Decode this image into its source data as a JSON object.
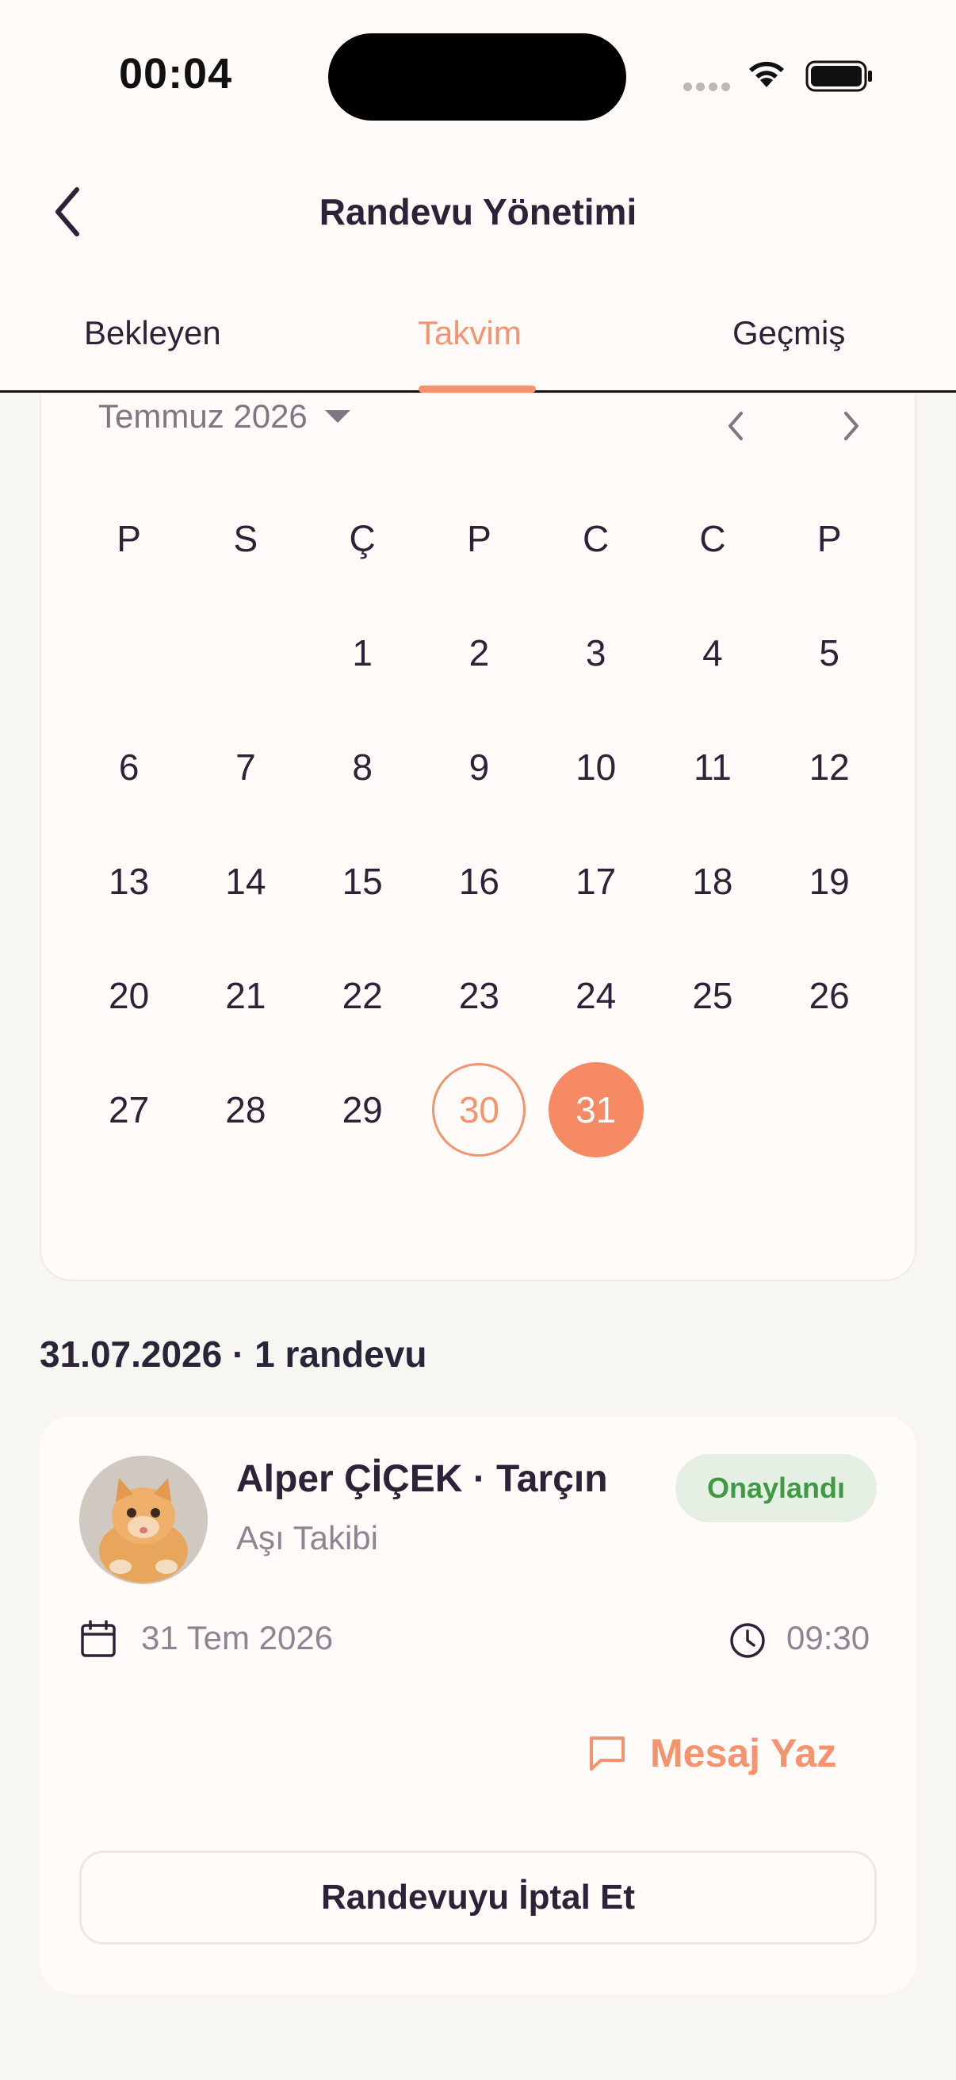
{
  "status_bar": {
    "time": "00:04"
  },
  "header": {
    "title": "Randevu Yönetimi",
    "back_icon": "chevron-left-icon"
  },
  "tabs": [
    {
      "label": "Bekleyen",
      "active": false
    },
    {
      "label": "Takvim",
      "active": true
    },
    {
      "label": "Geçmiş",
      "active": false
    }
  ],
  "calendar": {
    "month_label": "Temmuz 2026",
    "weekdays": [
      "P",
      "S",
      "Ç",
      "P",
      "C",
      "C",
      "P"
    ],
    "weeks": [
      [
        "",
        "",
        "1",
        "2",
        "3",
        "4",
        "5"
      ],
      [
        "6",
        "7",
        "8",
        "9",
        "10",
        "11",
        "12"
      ],
      [
        "13",
        "14",
        "15",
        "16",
        "17",
        "18",
        "19"
      ],
      [
        "20",
        "21",
        "22",
        "23",
        "24",
        "25",
        "26"
      ],
      [
        "27",
        "28",
        "29",
        "30",
        "31",
        "",
        ""
      ]
    ],
    "today": "30",
    "selected": "31",
    "accent_color": "#f58a64"
  },
  "section": {
    "title": "31.07.2026 · 1 randevu"
  },
  "appointment": {
    "title": "Alper ÇİÇEK · Tarçın",
    "service": "Aşı Takibi",
    "status": "Onaylandı",
    "status_color": "#3f9a46",
    "date": "31 Tem 2026",
    "time": "09:30",
    "message_label": "Mesaj Yaz",
    "cancel_label": "Randevuyu İptal Et"
  }
}
